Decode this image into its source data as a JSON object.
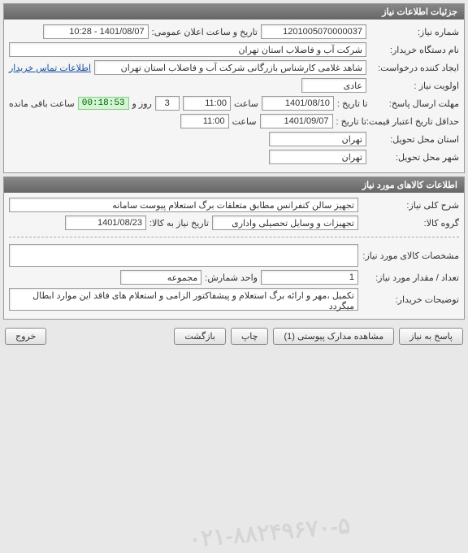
{
  "panel1": {
    "title": "جزئیات اطلاعات نیاز",
    "need_no_label": "شماره نیاز:",
    "need_no": "1201005070000037",
    "pub_date_label": "تاریخ و ساعت اعلان عمومی:",
    "pub_date": "1401/08/07 - 10:28",
    "org_label": "نام دستگاه خریدار:",
    "org": "شرکت آب و فاضلاب استان تهران",
    "creator_label": "ایجاد کننده درخواست:",
    "creator": "شاهد غلامی کارشناس بازرگانی شرکت آب و فاضلاب استان تهران",
    "contact_link": "اطلاعات تماس خریدار",
    "priority_label": "اولویت نیاز :",
    "priority": "عادی",
    "deadline_label": "مهلت ارسال پاسخ:",
    "to_date_label": "تا تاریخ :",
    "deadline_date": "1401/08/10",
    "time_label": "ساعت",
    "deadline_time": "11:00",
    "days": "3",
    "days_label": "روز و",
    "remain": "00:18:53",
    "remain_label": "ساعت باقی مانده",
    "credit_label": "حداقل تاریخ اعتبار قیمت:",
    "credit_date": "1401/09/07",
    "credit_time": "11:00",
    "province_label": "استان محل تحویل:",
    "province": "تهران",
    "city_label": "شهر محل تحویل:",
    "city": "تهران"
  },
  "panel2": {
    "title": "اطلاعات کالاهای مورد نیاز",
    "desc_label": "شرح کلی نیاز:",
    "desc": "تجهیز سالن کنفرانس مطابق متعلقات برگ استعلام پیوست سامانه",
    "group_label": "گروه کالا:",
    "group": "تجهیزات و وسایل تحصیلی واداری",
    "needdate_label": "تاریخ نیاز به کالا:",
    "needdate": "1401/08/23",
    "spec_label": "مشخصات کالای مورد نیاز:",
    "spec": "",
    "qty_label": "تعداد / مقدار مورد نیاز:",
    "qty": "1",
    "unit_label": "واحد شمارش:",
    "unit": "مجموعه",
    "notes_label": "توضیحات خریدار:",
    "notes": "تکمیل ،مهر و ارائه برگ استعلام و پیشفاکتور الزامی و استعلام های فاقد این موارد ابطال میگردد"
  },
  "buttons": {
    "respond": "پاسخ به نیاز",
    "attachments": "مشاهده مدارک پیوستی (1)",
    "print": "چاپ",
    "back": "بازگشت",
    "exit": "خروج"
  },
  "watermark": "۰۲۱-۸۸۲۴۹۶۷۰-۵"
}
